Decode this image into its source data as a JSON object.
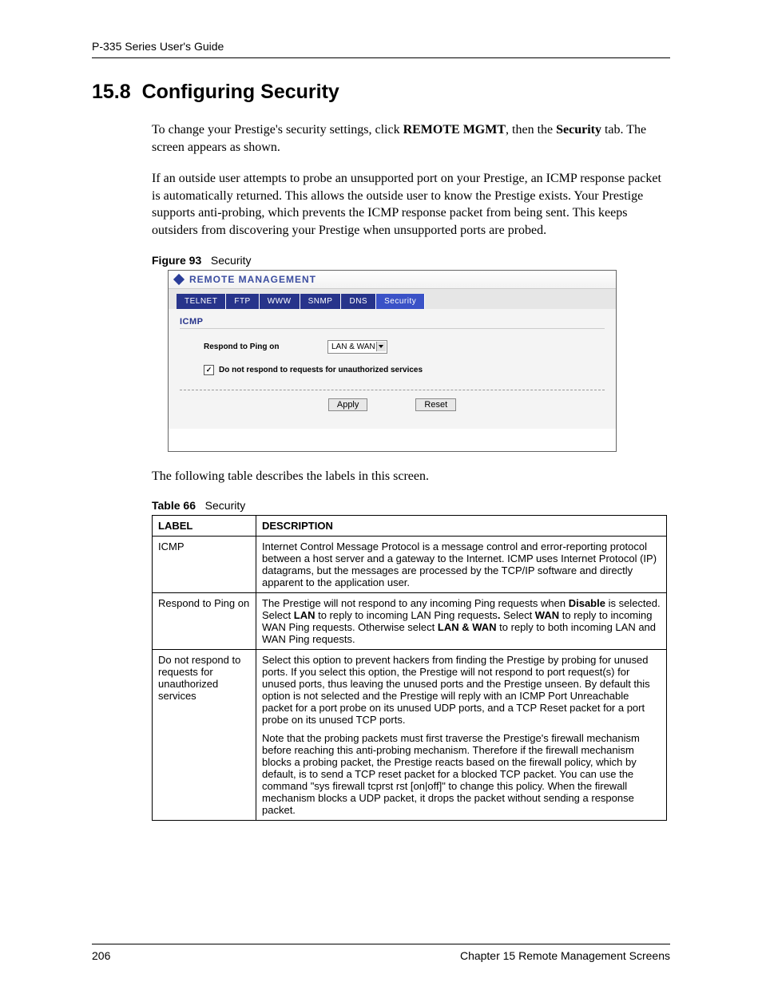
{
  "header": {
    "guide_title": "P-335 Series User's Guide"
  },
  "section": {
    "number": "15.8",
    "title": "Configuring Security",
    "para1_pre": "To change your Prestige's security settings, click ",
    "para1_b1": "REMOTE MGMT",
    "para1_mid": ", then the ",
    "para1_b2": "Security",
    "para1_post": " tab. The screen appears as shown.",
    "para2": "If an outside user attempts to probe an unsupported port on your Prestige, an ICMP response packet is automatically returned.  This allows the outside user to know the Prestige exists. Your Prestige supports anti-probing, which prevents the ICMP response packet from being sent. This keeps outsiders from discovering your Prestige when unsupported ports are probed.",
    "para3": "The following table describes the labels in this screen."
  },
  "figure": {
    "label": "Figure 93",
    "title": "Security",
    "window_title": "REMOTE MANAGEMENT",
    "tabs": [
      "TELNET",
      "FTP",
      "WWW",
      "SNMP",
      "DNS",
      "Security"
    ],
    "active_tab_index": 5,
    "subheading": "ICMP",
    "row1_label": "Respond to Ping on",
    "row1_value": "LAN & WAN",
    "checkbox_checked": true,
    "checkbox_label": "Do not respond to requests for unauthorized services",
    "apply": "Apply",
    "reset": "Reset"
  },
  "table": {
    "label": "Table 66",
    "title": "Security",
    "head_label": "LABEL",
    "head_desc": "DESCRIPTION",
    "rows": [
      {
        "label": "ICMP",
        "desc": "Internet Control Message Protocol is a message control and error-reporting protocol between a host server and a gateway to the Internet. ICMP uses Internet Protocol (IP) datagrams, but the messages are processed by the TCP/IP software and directly apparent to the application user."
      },
      {
        "label": "Respond to Ping on",
        "desc_parts": {
          "a": "The Prestige will not respond to any incoming Ping requests when ",
          "b1": "Disable",
          "b": " is selected. Select ",
          "b2": "LAN",
          "c": " to reply to incoming LAN Ping requests",
          "b3": ".",
          "d": " Select ",
          "b4": "WAN",
          "e": " to reply to incoming WAN Ping requests. Otherwise select ",
          "b5": "LAN & WAN",
          "f": " to reply to both incoming LAN and WAN Ping requests."
        }
      },
      {
        "label": "Do not respond to requests for unauthorized services",
        "desc_p1": "Select this option to prevent hackers from finding the Prestige by probing for unused ports. If you select this option, the Prestige will not respond to port request(s) for unused ports, thus leaving the unused ports and the Prestige unseen. By default this option is not selected and the Prestige will reply with an ICMP Port Unreachable packet for a port probe on its unused UDP ports, and a TCP Reset packet for a port probe on its unused TCP ports.",
        "desc_p2": "Note that the probing packets must first traverse the Prestige's firewall mechanism before reaching this anti-probing mechanism. Therefore if the firewall mechanism blocks a probing packet, the Prestige reacts based on the firewall policy, which by default, is to send a TCP reset packet for a blocked TCP packet. You can use the command \"sys firewall tcprst rst [on|off]\" to change this policy. When the firewall mechanism blocks a UDP packet, it drops the packet without sending a response packet."
      }
    ]
  },
  "footer": {
    "page": "206",
    "chapter": "Chapter 15 Remote Management Screens"
  },
  "chart_data": {
    "type": "table",
    "title": "Table 66  Security",
    "columns": [
      "LABEL",
      "DESCRIPTION"
    ],
    "rows": [
      [
        "ICMP",
        "Internet Control Message Protocol is a message control and error-reporting protocol between a host server and a gateway to the Internet. ICMP uses Internet Protocol (IP) datagrams, but the messages are processed by the TCP/IP software and directly apparent to the application user."
      ],
      [
        "Respond to Ping on",
        "The Prestige will not respond to any incoming Ping requests when Disable is selected. Select LAN to reply to incoming LAN Ping requests. Select WAN to reply to incoming WAN Ping requests. Otherwise select LAN & WAN to reply to both incoming LAN and WAN Ping requests."
      ],
      [
        "Do not respond to requests for unauthorized services",
        "Select this option to prevent hackers from finding the Prestige by probing for unused ports. If you select this option, the Prestige will not respond to port request(s) for unused ports, thus leaving the unused ports and the Prestige unseen. By default this option is not selected and the Prestige will reply with an ICMP Port Unreachable packet for a port probe on its unused UDP ports, and a TCP Reset packet for a port probe on its unused TCP ports. Note that the probing packets must first traverse the Prestige's firewall mechanism before reaching this anti-probing mechanism. Therefore if the firewall mechanism blocks a probing packet, the Prestige reacts based on the firewall policy, which by default, is to send a TCP reset packet for a blocked TCP packet. You can use the command \"sys firewall tcprst rst [on|off]\" to change this policy. When the firewall mechanism blocks a UDP packet, it drops the packet without sending a response packet."
      ]
    ]
  }
}
